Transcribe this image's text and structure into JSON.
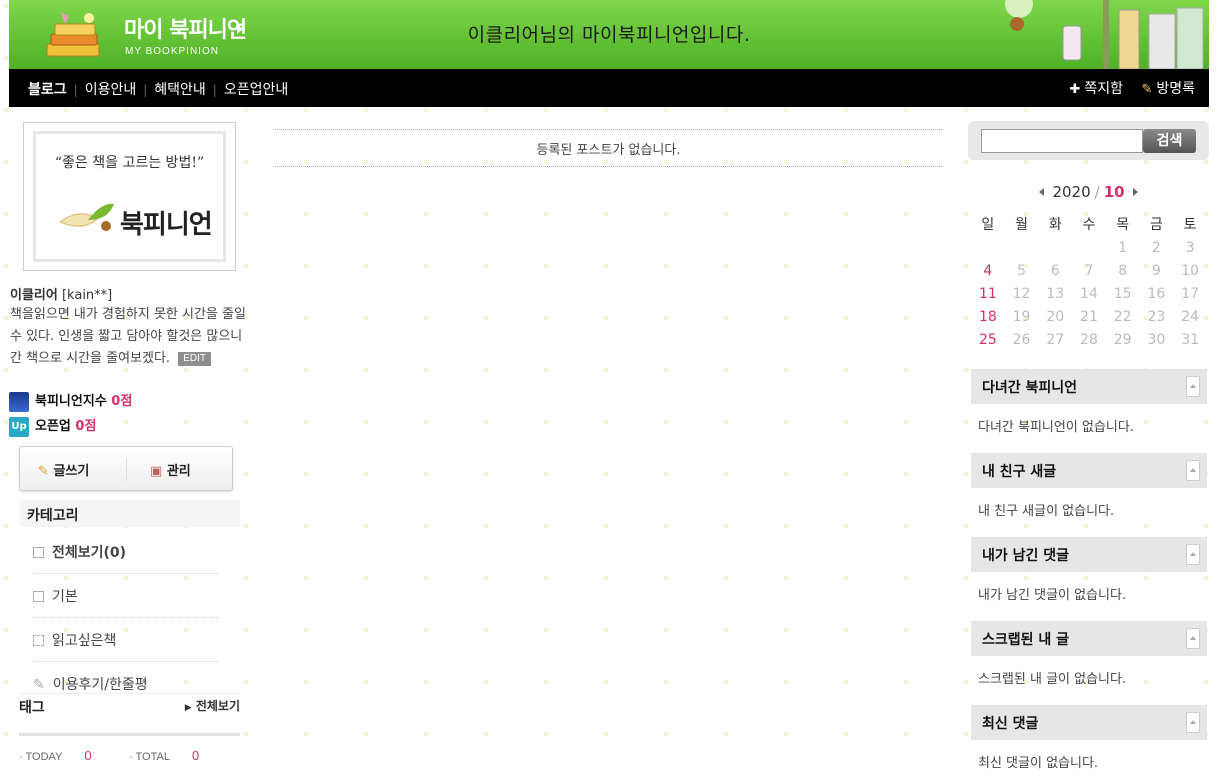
{
  "header": {
    "logo_ko": "마이 북피니언",
    "logo_en": "MY BOOKPINION",
    "title": "이클리어님의 마이북피니언입니다."
  },
  "nav": {
    "left": [
      "블로그",
      "이용안내",
      "혜택안내",
      "오픈업안내"
    ],
    "message_box": "쪽지함",
    "guestbook": "방명록"
  },
  "banner": {
    "quote": "“좋은 책을 고르는 방법!”",
    "name": "북피니언"
  },
  "profile": {
    "nickname": "이클리어",
    "user_id": "[kain**]",
    "description": "책을읽으면 내가 경험하지 못한 시간을 줄일수 있다. 인생을 짧고 담아야 할것은 많으니간 책으로 시간을 줄여보겠다.",
    "edit_label": "EDIT"
  },
  "scores": {
    "bookpinion_label": "북피니언지수",
    "bookpinion_value": "0점",
    "openup_label": "오픈업",
    "openup_value": "0점"
  },
  "buttons": {
    "write": "글쓰기",
    "manage": "관리"
  },
  "category": {
    "title": "카테고리",
    "items": [
      {
        "label": "전체보기(0)"
      },
      {
        "label": "기본"
      },
      {
        "label": "읽고싶은책"
      },
      {
        "label": "이용후기/한줄평"
      }
    ]
  },
  "tags": {
    "title": "태그",
    "view_all": "전체보기"
  },
  "counter": {
    "today_label": "TODAY",
    "today_value": "0",
    "total_label": "TOTAL",
    "total_value": "0"
  },
  "main": {
    "empty_message": "등록된 포스트가 없습니다."
  },
  "search": {
    "button": "검색",
    "value": ""
  },
  "calendar": {
    "year": "2020",
    "month": "10",
    "weekdays": [
      "일",
      "월",
      "화",
      "수",
      "목",
      "금",
      "토"
    ],
    "weeks": [
      [
        "",
        "",
        "",
        "",
        "1",
        "2",
        "3"
      ],
      [
        "4",
        "5",
        "6",
        "7",
        "8",
        "9",
        "10"
      ],
      [
        "11",
        "12",
        "13",
        "14",
        "15",
        "16",
        "17"
      ],
      [
        "18",
        "19",
        "20",
        "21",
        "22",
        "23",
        "24"
      ],
      [
        "25",
        "26",
        "27",
        "28",
        "29",
        "30",
        "31"
      ]
    ]
  },
  "widgets": [
    {
      "title": "다녀간 북피니언",
      "empty": "다녀간 북피니언이 없습니다."
    },
    {
      "title": "내 친구 새글",
      "empty": "내 친구 새글이 없습니다."
    },
    {
      "title": "내가 남긴 댓글",
      "empty": "내가 남긴 댓글이 없습니다."
    },
    {
      "title": "스크랩된 내 글",
      "empty": "스크랩된 내 글이 없습니다."
    },
    {
      "title": "최신 댓글",
      "empty": "최신 댓글이 없습니다."
    }
  ],
  "colors": {
    "header_green": "#5cbf2e",
    "accent_pink": "#d6306a",
    "nav_black": "#000000"
  }
}
